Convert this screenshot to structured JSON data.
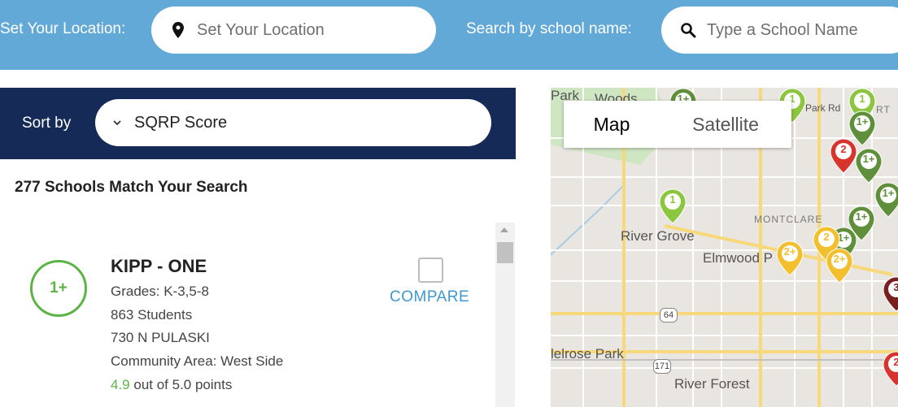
{
  "search": {
    "location_label": "Set Your Location:",
    "location_placeholder": "Set Your Location",
    "school_label": "Search by school name:",
    "school_placeholder": "Type a School Name"
  },
  "sort": {
    "label": "Sort by",
    "selected": "SQRP Score"
  },
  "results": {
    "count_text": "277 Schools Match Your Search"
  },
  "school": {
    "rating": "1+",
    "name": "KIPP - ONE",
    "grades": "Grades: K-3,5-8",
    "students": "863 Students",
    "address": "730 N PULASKI",
    "community": "Community Area: West Side",
    "score_value": "4.9",
    "score_suffix": " out of 5.0 points",
    "compare_label": "COMPARE"
  },
  "map": {
    "toggle_map": "Map",
    "toggle_satellite": "Satellite",
    "places": {
      "park": "Park",
      "woods": "Woods",
      "park_rd": "Park Rd",
      "rt": "RT",
      "montclare": "MONTCLARE",
      "river_grove": "River Grove",
      "elmwood": "Elmwood P",
      "melrose": "lelrose Park",
      "river_forest": "River Forest"
    },
    "route_64": "64",
    "route_171": "171",
    "pin_colors": {
      "light_green": "#8cc63f",
      "dark_green": "#5f8f3a",
      "yellow": "#f2bf2f",
      "red": "#d6342d",
      "dark_red": "#7a1f1f"
    },
    "pins": [
      {
        "label": "1",
        "color": "light_green"
      },
      {
        "label": "1",
        "color": "light_green"
      },
      {
        "label": "1",
        "color": "light_green"
      },
      {
        "label": "1+",
        "color": "dark_green"
      },
      {
        "label": "1+",
        "color": "dark_green"
      },
      {
        "label": "1+",
        "color": "dark_green"
      },
      {
        "label": "1+",
        "color": "dark_green"
      },
      {
        "label": "1+",
        "color": "dark_green"
      },
      {
        "label": "1+",
        "color": "dark_green"
      },
      {
        "label": "2",
        "color": "red"
      },
      {
        "label": "2",
        "color": "yellow"
      },
      {
        "label": "2+",
        "color": "yellow"
      },
      {
        "label": "2+",
        "color": "yellow"
      },
      {
        "label": "3",
        "color": "dark_red"
      },
      {
        "label": "2",
        "color": "red"
      }
    ]
  },
  "colors": {
    "topbar": "#62a9d8",
    "sortbar": "#152a56",
    "rating_green": "#5bb446",
    "compare_blue": "#3f97d2"
  }
}
